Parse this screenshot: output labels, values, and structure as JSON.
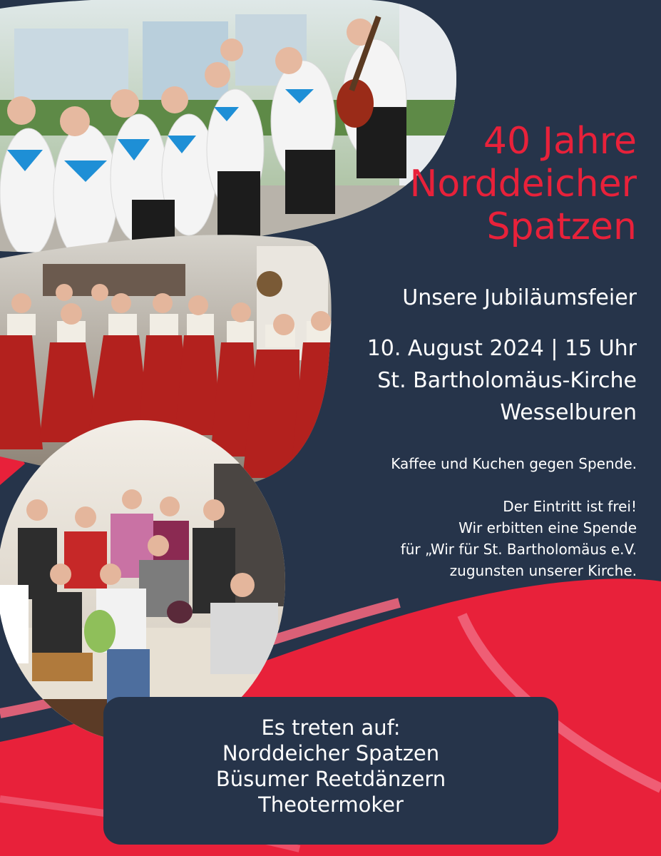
{
  "colors": {
    "navy": "#26344a",
    "red": "#e8213a",
    "pink_stripe": "#f0657c",
    "text_white": "#ffffff"
  },
  "title": {
    "line1": "40 Jahre",
    "line2": "Norddeicher",
    "line3": "Spatzen"
  },
  "subtitle": "Unsere Jubiläumsfeier",
  "event": {
    "date_time": "10. August 2024 | 15 Uhr",
    "venue": "St. Bartholomäus-Kirche",
    "town": "Wesselburen"
  },
  "note": {
    "coffee": "Kaffee und Kuchen gegen Spende.",
    "line1": "Der Eintritt ist frei!",
    "line2": "Wir erbitten eine Spende",
    "line3": "für „Wir für St. Bartholomäus e.V.",
    "line4": "zugunsten unserer Kirche."
  },
  "lineup": {
    "heading": "Es treten auf:",
    "acts": [
      "Norddeicher Spatzen",
      "Büsumer Reetdänzern",
      "Theotermoker"
    ]
  },
  "photos": [
    {
      "name": "choir-white-shirts-photo"
    },
    {
      "name": "dancers-red-costumes-photo"
    },
    {
      "name": "theatre-group-photo"
    }
  ]
}
